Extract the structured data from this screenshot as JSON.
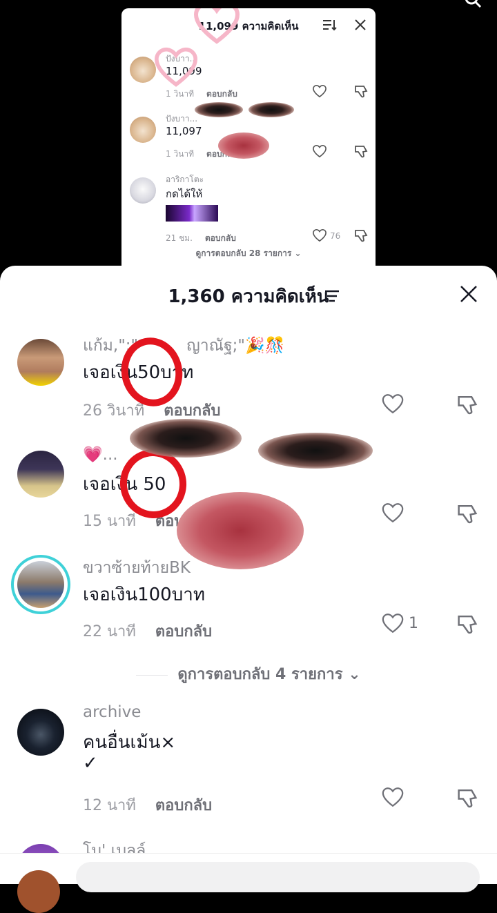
{
  "inner_sheet": {
    "title": "11,099 ความคิดเห็น",
    "comments": [
      {
        "name": "ปังบาา...",
        "text": "11,099",
        "time": "1 วินาที",
        "reply": "ตอบกลับ",
        "likes": ""
      },
      {
        "name": "ปังบาา...",
        "text": "11,097",
        "time": "1 วินาที",
        "reply": "ตอบกลับ",
        "likes": ""
      },
      {
        "name": "อาริกาโตะ",
        "text": "กดได้ให้",
        "time": "21 ชม.",
        "reply": "ตอบกลับ",
        "likes": "76"
      }
    ],
    "view_replies": "ดูการตอบกลับ 28 รายการ ⌄"
  },
  "sheet": {
    "title": "1,360 ความคิดเห็น",
    "comments": [
      {
        "name": "แก้ม,\":\"",
        "name_tail": "ญาณัฐ;\"🎉🎊",
        "text": "เจอเงิน50บาท",
        "time": "26 วินาที",
        "reply": "ตอบกลับ",
        "likes": ""
      },
      {
        "name": "💗...",
        "text": "เจอเงิน 50",
        "time": "15 นาที",
        "reply": "ตอบกลับ",
        "likes": ""
      },
      {
        "name": "ขวาซ้ายท้ายBK",
        "text": "เจอเงิน100บาท",
        "time": "22 นาที",
        "reply": "ตอบกลับ",
        "likes": "1"
      },
      {
        "name": "archive",
        "text": "คนอื่นเม้น×",
        "text2": "✓",
        "time": "12 นาที",
        "reply": "ตอบกลับ",
        "likes": ""
      },
      {
        "name": "โบ' เบลล์",
        "text": "",
        "time": "",
        "reply": "",
        "likes": ""
      }
    ],
    "view_replies": "ดูการตอบกลับ 4 รายการ ⌄"
  },
  "colors": {
    "accent_red": "#e3141e",
    "ring_cyan": "#3fd1d8",
    "text_primary": "#161823",
    "text_muted": "#8a8b91"
  },
  "icons": [
    "search-icon",
    "sort-icon",
    "close-icon",
    "filter-icon",
    "heart-icon",
    "dislike-icon"
  ]
}
